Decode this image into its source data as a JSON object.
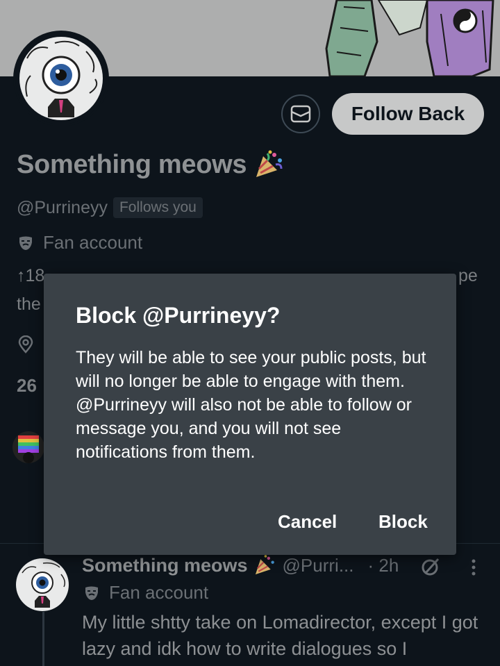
{
  "profile": {
    "display_name": "Something meows",
    "handle": "@Purrineyy",
    "follows_you_badge": "Follows you",
    "category": "Fan account",
    "bio_line1_left": "↑18",
    "bio_line1_right": "pe",
    "bio_line2_left": "the",
    "following_count_fragment": "26",
    "follow_back_label": "Follow Back"
  },
  "dialog": {
    "title": "Block @Purrineyy?",
    "body": "They will be able to see your public posts, but will no longer be able to engage with them. @Purrineyy will also not be able to follow or message you, and you will not see notifications from them.",
    "cancel_label": "Cancel",
    "confirm_label": "Block"
  },
  "post": {
    "author_name": "Something meows",
    "author_handle": "@Purri...",
    "time": "· 2h",
    "category": "Fan account",
    "text": "My little shtty take on Lomadirector, except I got lazy and idk how to write dialogues so I"
  },
  "icons": {
    "message": "envelope-icon",
    "party": "party-popper-icon",
    "mask": "theater-mask-icon",
    "location": "location-pin-icon",
    "grok": "grok-icon",
    "more": "more-vertical-icon"
  },
  "colors": {
    "background": "#0d141b",
    "dialog": "#3a4147",
    "follow_button": "#c7c8c8"
  }
}
